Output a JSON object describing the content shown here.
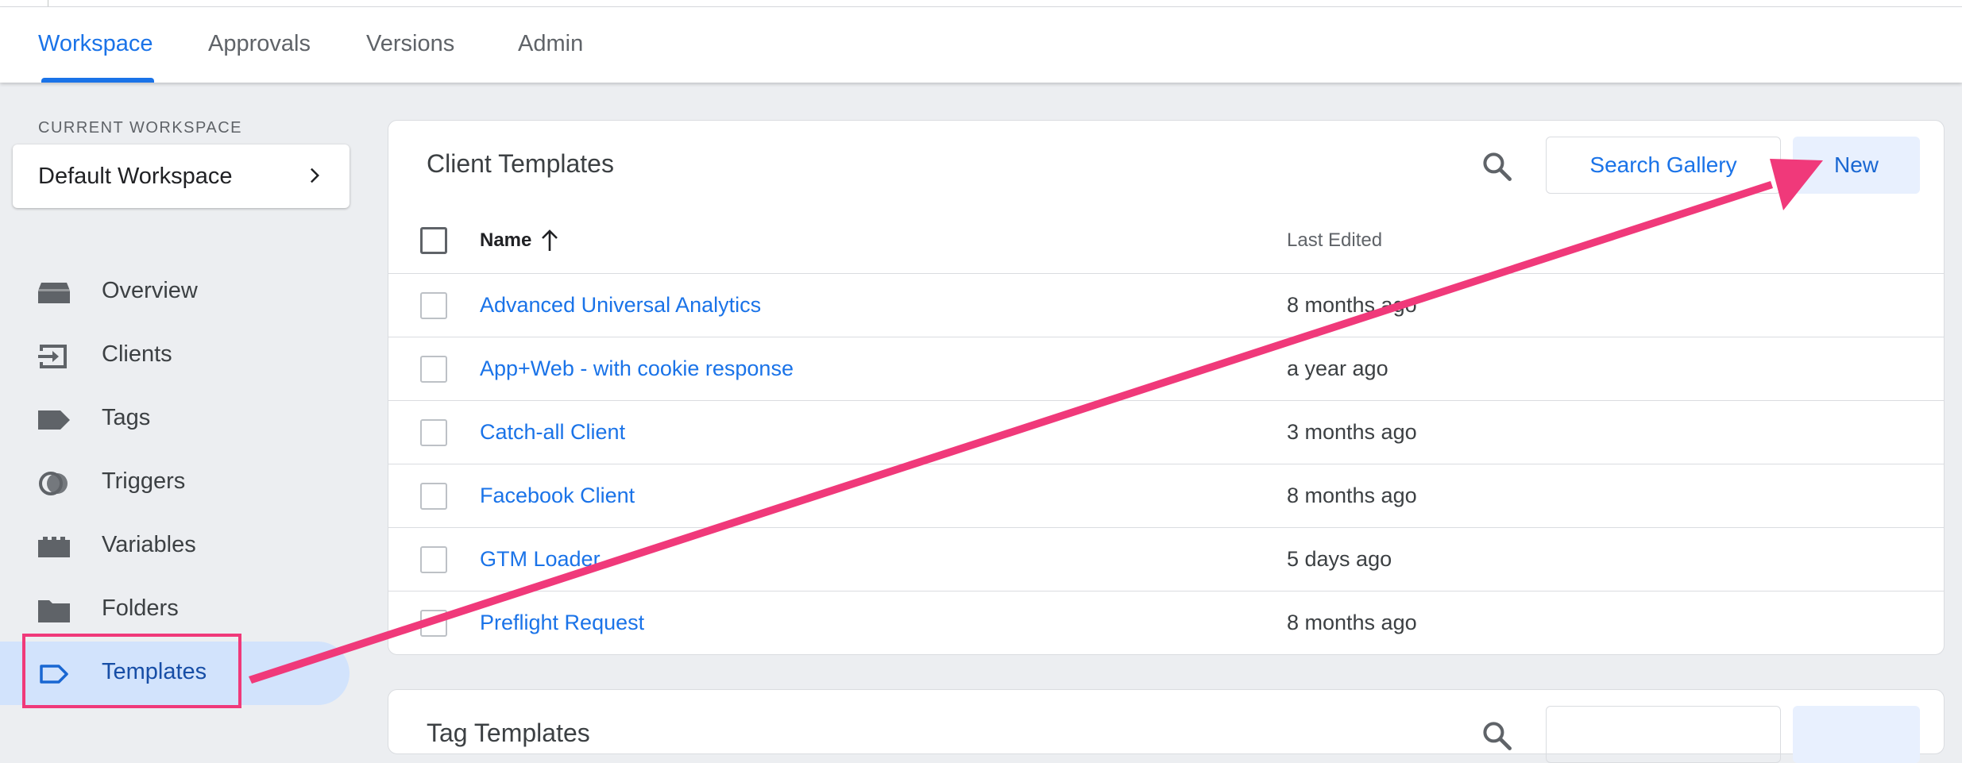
{
  "tabs": [
    {
      "label": "Workspace",
      "active": true
    },
    {
      "label": "Approvals"
    },
    {
      "label": "Versions"
    },
    {
      "label": "Admin"
    }
  ],
  "workspace": {
    "section_label": "CURRENT WORKSPACE",
    "name": "Default Workspace"
  },
  "nav": [
    {
      "label": "Overview",
      "icon": "overview-icon"
    },
    {
      "label": "Clients",
      "icon": "clients-icon"
    },
    {
      "label": "Tags",
      "icon": "tag-icon"
    },
    {
      "label": "Triggers",
      "icon": "triggers-icon"
    },
    {
      "label": "Variables",
      "icon": "variables-icon"
    },
    {
      "label": "Folders",
      "icon": "folder-icon"
    },
    {
      "label": "Templates",
      "icon": "templates-icon",
      "active": true
    }
  ],
  "client_templates": {
    "title": "Client Templates",
    "search_gallery_label": "Search Gallery",
    "new_label": "New",
    "columns": {
      "name": "Name",
      "last_edited": "Last Edited"
    },
    "rows": [
      {
        "name": "Advanced Universal Analytics",
        "last_edited": "8 months ago"
      },
      {
        "name": "App+Web - with cookie response",
        "last_edited": "a year ago"
      },
      {
        "name": "Catch-all Client",
        "last_edited": "3 months ago"
      },
      {
        "name": "Facebook Client",
        "last_edited": "8 months ago"
      },
      {
        "name": "GTM Loader",
        "last_edited": "5 days ago"
      },
      {
        "name": "Preflight Request",
        "last_edited": "8 months ago"
      }
    ]
  },
  "tag_templates": {
    "title": "Tag Templates"
  },
  "annotation": {
    "color": "#f0397a"
  },
  "colors": {
    "accent": "#1a73e8",
    "active_nav_bg": "#d2e3fc",
    "new_button_bg": "#e8f0fe"
  }
}
